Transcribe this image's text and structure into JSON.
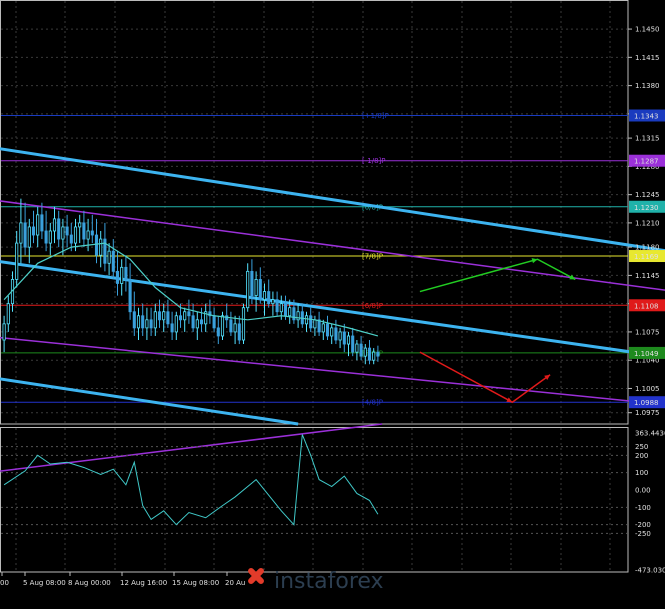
{
  "chart_data": [
    {
      "type": "candlestick",
      "pane": "price",
      "y_ticks": [
        "1.1450",
        "1.1415",
        "1.1380",
        "1.1345",
        "1.1315",
        "1.1280",
        "1.1245",
        "1.1210",
        "1.1180",
        "1.1145",
        "1.1110",
        "1.1075",
        "1.1040",
        "1.1005",
        "1.0975"
      ],
      "ylim": [
        1.0961,
        1.1486
      ],
      "grid": true,
      "x_ticks": [
        "00",
        "5 Aug 08:00",
        "8 Aug 00:00",
        "12 Aug 16:00",
        "15 Aug 08:00",
        "20 Au"
      ],
      "price_labels": [
        "1.1343",
        "1.1287",
        "1.1230",
        "1.1169",
        "1.1108",
        "1.1049",
        "1.0988"
      ],
      "levels": [
        {
          "label": "[+1/8]P",
          "value": 1.1343,
          "color": "#1a3bbf"
        },
        {
          "label": "[-1/8]P",
          "value": 1.1287,
          "color": "#9b30d9"
        },
        {
          "label": "[0/8]P",
          "value": 1.123,
          "color": "#20b2aa"
        },
        {
          "label": "[7/8]P",
          "value": 1.1169,
          "color": "#e8e830"
        },
        {
          "label": "[6/8]P",
          "value": 1.1108,
          "color": "#e01a1a"
        },
        {
          "label": "[5/8]P",
          "value": 1.1049,
          "color": "#1e8a1e"
        },
        {
          "label": "[4/8]P",
          "value": 1.0988,
          "color": "#2233cc"
        }
      ],
      "candle_count": 90,
      "candles": [
        [
          1.1065,
          1.1095,
          1.105,
          1.1085
        ],
        [
          1.1085,
          1.112,
          1.1075,
          1.111
        ],
        [
          1.111,
          1.115,
          1.11,
          1.114
        ],
        [
          1.114,
          1.12,
          1.113,
          1.1185
        ],
        [
          1.1185,
          1.124,
          1.116,
          1.121
        ],
        [
          1.121,
          1.1235,
          1.117,
          1.118
        ],
        [
          1.118,
          1.1215,
          1.116,
          1.1205
        ],
        [
          1.1205,
          1.1225,
          1.1185,
          1.1195
        ],
        [
          1.1195,
          1.123,
          1.118,
          1.122
        ],
        [
          1.122,
          1.1235,
          1.119,
          1.12
        ],
        [
          1.12,
          1.1225,
          1.1175,
          1.1185
        ],
        [
          1.1185,
          1.121,
          1.117,
          1.12
        ],
        [
          1.12,
          1.123,
          1.1185,
          1.1215
        ],
        [
          1.1215,
          1.1225,
          1.118,
          1.119
        ],
        [
          1.119,
          1.1215,
          1.117,
          1.1205
        ],
        [
          1.1205,
          1.122,
          1.118,
          1.1195
        ],
        [
          1.1195,
          1.121,
          1.1175,
          1.1185
        ],
        [
          1.1185,
          1.1215,
          1.1175,
          1.1205
        ],
        [
          1.1205,
          1.122,
          1.1185,
          1.121
        ],
        [
          1.121,
          1.1225,
          1.118,
          1.119
        ],
        [
          1.119,
          1.1215,
          1.1175,
          1.12
        ],
        [
          1.12,
          1.122,
          1.1185,
          1.1195
        ],
        [
          1.1195,
          1.1215,
          1.116,
          1.117
        ],
        [
          1.117,
          1.12,
          1.1155,
          1.119
        ],
        [
          1.119,
          1.121,
          1.115,
          1.116
        ],
        [
          1.116,
          1.1185,
          1.1145,
          1.1175
        ],
        [
          1.1175,
          1.119,
          1.114,
          1.115
        ],
        [
          1.115,
          1.1175,
          1.112,
          1.1135
        ],
        [
          1.1135,
          1.1165,
          1.112,
          1.1155
        ],
        [
          1.1155,
          1.117,
          1.1125,
          1.114
        ],
        [
          1.114,
          1.116,
          1.109,
          1.11
        ],
        [
          1.11,
          1.1125,
          1.107,
          1.108
        ],
        [
          1.108,
          1.1105,
          1.1065,
          1.1095
        ],
        [
          1.1095,
          1.111,
          1.107,
          1.108
        ],
        [
          1.108,
          1.1105,
          1.1065,
          1.109
        ],
        [
          1.109,
          1.1105,
          1.107,
          1.108
        ],
        [
          1.108,
          1.111,
          1.107,
          1.11
        ],
        [
          1.11,
          1.1115,
          1.108,
          1.109
        ],
        [
          1.109,
          1.111,
          1.1075,
          1.11
        ],
        [
          1.11,
          1.1115,
          1.108,
          1.1085
        ],
        [
          1.1085,
          1.11,
          1.1065,
          1.1075
        ],
        [
          1.1075,
          1.11,
          1.1065,
          1.1095
        ],
        [
          1.1095,
          1.111,
          1.108,
          1.109
        ],
        [
          1.109,
          1.1105,
          1.1075,
          1.11
        ],
        [
          1.11,
          1.1115,
          1.1085,
          1.1095
        ],
        [
          1.1095,
          1.111,
          1.1075,
          1.108
        ],
        [
          1.108,
          1.11,
          1.1065,
          1.109
        ],
        [
          1.109,
          1.1105,
          1.1075,
          1.1085
        ],
        [
          1.1085,
          1.111,
          1.1075,
          1.11
        ],
        [
          1.11,
          1.1115,
          1.1085,
          1.1095
        ],
        [
          1.1095,
          1.1105,
          1.1075,
          1.108
        ],
        [
          1.108,
          1.1095,
          1.106,
          1.107
        ],
        [
          1.107,
          1.11,
          1.1065,
          1.1095
        ],
        [
          1.1095,
          1.111,
          1.108,
          1.109
        ],
        [
          1.109,
          1.11,
          1.107,
          1.1075
        ],
        [
          1.1075,
          1.1095,
          1.106,
          1.1085
        ],
        [
          1.1085,
          1.1095,
          1.106,
          1.1065
        ],
        [
          1.1065,
          1.111,
          1.106,
          1.1105
        ],
        [
          1.1105,
          1.116,
          1.11,
          1.115
        ],
        [
          1.115,
          1.1165,
          1.111,
          1.112
        ],
        [
          1.112,
          1.115,
          1.11,
          1.114
        ],
        [
          1.114,
          1.1155,
          1.111,
          1.1115
        ],
        [
          1.1115,
          1.1135,
          1.1095,
          1.1125
        ],
        [
          1.1125,
          1.114,
          1.1105,
          1.111
        ],
        [
          1.111,
          1.1125,
          1.1095,
          1.1115
        ],
        [
          1.1115,
          1.1125,
          1.1095,
          1.11
        ],
        [
          1.11,
          1.112,
          1.109,
          1.111
        ],
        [
          1.111,
          1.112,
          1.109,
          1.1095
        ],
        [
          1.1095,
          1.1115,
          1.1085,
          1.1105
        ],
        [
          1.1105,
          1.1115,
          1.1085,
          1.109
        ],
        [
          1.109,
          1.111,
          1.108,
          1.11
        ],
        [
          1.11,
          1.111,
          1.108,
          1.1085
        ],
        [
          1.1085,
          1.11,
          1.1075,
          1.1095
        ],
        [
          1.1095,
          1.1105,
          1.1075,
          1.108
        ],
        [
          1.108,
          1.1095,
          1.107,
          1.109
        ],
        [
          1.109,
          1.11,
          1.107,
          1.1075
        ],
        [
          1.1075,
          1.109,
          1.1065,
          1.1085
        ],
        [
          1.1085,
          1.1095,
          1.1065,
          1.107
        ],
        [
          1.107,
          1.1085,
          1.106,
          1.108
        ],
        [
          1.108,
          1.109,
          1.106,
          1.1065
        ],
        [
          1.1065,
          1.108,
          1.1055,
          1.1075
        ],
        [
          1.1075,
          1.1085,
          1.105,
          1.106
        ],
        [
          1.106,
          1.1075,
          1.1045,
          1.107
        ],
        [
          1.107,
          1.108,
          1.1045,
          1.105
        ],
        [
          1.105,
          1.1065,
          1.104,
          1.106
        ],
        [
          1.106,
          1.107,
          1.104,
          1.1045
        ],
        [
          1.1045,
          1.106,
          1.1035,
          1.1055
        ],
        [
          1.1055,
          1.1065,
          1.1035,
          1.104
        ],
        [
          1.104,
          1.1055,
          1.1035,
          1.105
        ],
        [
          1.105,
          1.1058,
          1.1038,
          1.1045
        ]
      ],
      "ma_series": [
        {
          "x": 0,
          "y": 1.1115
        },
        {
          "x": 8,
          "y": 1.116
        },
        {
          "x": 16,
          "y": 1.118
        },
        {
          "x": 24,
          "y": 1.1185
        },
        {
          "x": 30,
          "y": 1.1165
        },
        {
          "x": 36,
          "y": 1.113
        },
        {
          "x": 42,
          "y": 1.1105
        },
        {
          "x": 50,
          "y": 1.1095
        },
        {
          "x": 58,
          "y": 1.109
        },
        {
          "x": 66,
          "y": 1.1095
        },
        {
          "x": 74,
          "y": 1.109
        },
        {
          "x": 82,
          "y": 1.108
        },
        {
          "x": 89,
          "y": 1.107
        }
      ],
      "channel_lines": [
        {
          "color": "#3db4f0",
          "from": [
            -5,
            1.1305
          ],
          "to": [
            167,
            1.1168
          ]
        },
        {
          "color": "#3db4f0",
          "from": [
            -5,
            1.1165
          ],
          "to": [
            167,
            1.1037
          ]
        },
        {
          "color": "#3db4f0",
          "from": [
            -5,
            1.102
          ],
          "to": [
            70,
            1.0961
          ]
        },
        {
          "color": "#9b30d9",
          "from": [
            -5,
            1.124
          ],
          "to": [
            167,
            1.112
          ]
        },
        {
          "color": "#9b30d9",
          "from": [
            -5,
            1.107
          ],
          "to": [
            167,
            1.098
          ]
        },
        {
          "color": "#9b30d9",
          "from": [
            -5,
            1.09
          ],
          "to": [
            90,
            1.0961
          ]
        }
      ],
      "forecast_arrows": [
        {
          "color": "#22cc22",
          "points": [
            [
              99,
              1.1125
            ],
            [
              127,
              1.1165
            ],
            [
              136,
              1.114
            ]
          ]
        },
        {
          "color": "#e01a1a",
          "points": [
            [
              99,
              1.105
            ],
            [
              121,
              1.0988
            ],
            [
              130,
              1.1022
            ]
          ]
        }
      ]
    },
    {
      "type": "line",
      "pane": "oscillator",
      "y_ticks": [
        "363.4436",
        "250",
        "200",
        "100",
        "0.00",
        "-100",
        "-200",
        "-250",
        "-473.030"
      ],
      "ylim": [
        -473.03,
        363.4436
      ],
      "levels": [
        250,
        200,
        100,
        -100,
        -200,
        -250
      ],
      "series_color": "#40c8c8",
      "values": [
        {
          "x": 0,
          "y": 30
        },
        {
          "x": 5,
          "y": 110
        },
        {
          "x": 8,
          "y": 200
        },
        {
          "x": 11,
          "y": 150
        },
        {
          "x": 15,
          "y": 160
        },
        {
          "x": 19,
          "y": 130
        },
        {
          "x": 23,
          "y": 90
        },
        {
          "x": 26,
          "y": 120
        },
        {
          "x": 29,
          "y": 30
        },
        {
          "x": 31,
          "y": 160
        },
        {
          "x": 33,
          "y": -90
        },
        {
          "x": 35,
          "y": -170
        },
        {
          "x": 38,
          "y": -120
        },
        {
          "x": 41,
          "y": -200
        },
        {
          "x": 44,
          "y": -130
        },
        {
          "x": 48,
          "y": -160
        },
        {
          "x": 52,
          "y": -90
        },
        {
          "x": 55,
          "y": -40
        },
        {
          "x": 60,
          "y": 60
        },
        {
          "x": 63,
          "y": -30
        },
        {
          "x": 66,
          "y": -120
        },
        {
          "x": 69,
          "y": -200
        },
        {
          "x": 71,
          "y": 320
        },
        {
          "x": 73,
          "y": 200
        },
        {
          "x": 75,
          "y": 60
        },
        {
          "x": 78,
          "y": 20
        },
        {
          "x": 81,
          "y": 80
        },
        {
          "x": 84,
          "y": -20
        },
        {
          "x": 87,
          "y": -60
        },
        {
          "x": 89,
          "y": -140
        }
      ]
    }
  ],
  "watermark": {
    "brand": "instaforex",
    "logo_icon": "instaforex-logo-icon"
  }
}
